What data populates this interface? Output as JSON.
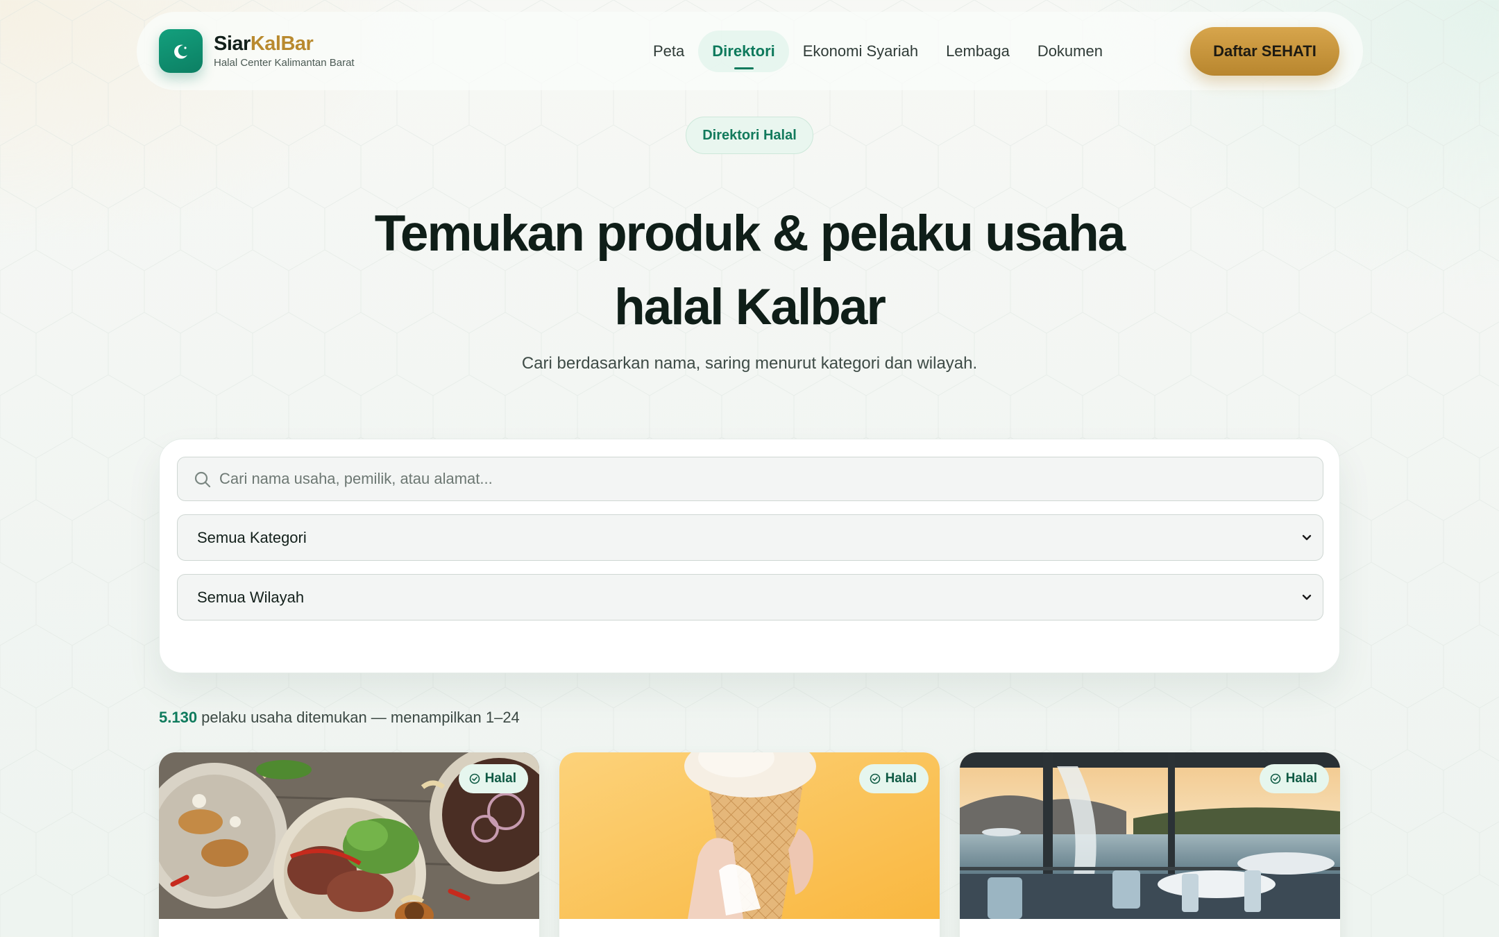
{
  "brand": {
    "name_part1": "Siar",
    "name_part2": "KalBar",
    "subtitle": "Halal Center Kalimantan Barat"
  },
  "nav": {
    "items": [
      {
        "label": "Peta",
        "active": false
      },
      {
        "label": "Direktori",
        "active": true
      },
      {
        "label": "Ekonomi Syariah",
        "active": false
      },
      {
        "label": "Lembaga",
        "active": false
      },
      {
        "label": "Dokumen",
        "active": false
      }
    ],
    "cta_label": "Daftar SEHATI"
  },
  "hero": {
    "pill": "Direktori Halal",
    "title_line1": "Temukan produk & pelaku usaha",
    "title_line2": "halal Kalbar",
    "subtitle": "Cari berdasarkan nama, saring menurut kategori dan wilayah."
  },
  "filters": {
    "search_placeholder": "Cari nama usaha, pemilik, atau alamat...",
    "search_value": "",
    "category_selected": "Semua Kategori",
    "region_selected": "Semua Wilayah"
  },
  "results": {
    "count": "5.130",
    "summary": " pelaku usaha ditemukan — menampilkan 1–24"
  },
  "cards": [
    {
      "badge": "Halal",
      "image": "grilled-food-bowls"
    },
    {
      "badge": "Halal",
      "image": "ice-cream-cone"
    },
    {
      "badge": "Halal",
      "image": "lakeside-restaurant-terrace"
    }
  ],
  "colors": {
    "primary": "#0e7a5c",
    "accent_gold": "#b98a2f",
    "badge_bg": "#e6f6ee"
  },
  "icons": [
    "crescent-moon-icon",
    "search-icon",
    "chevron-down-icon",
    "check-circle-icon"
  ]
}
